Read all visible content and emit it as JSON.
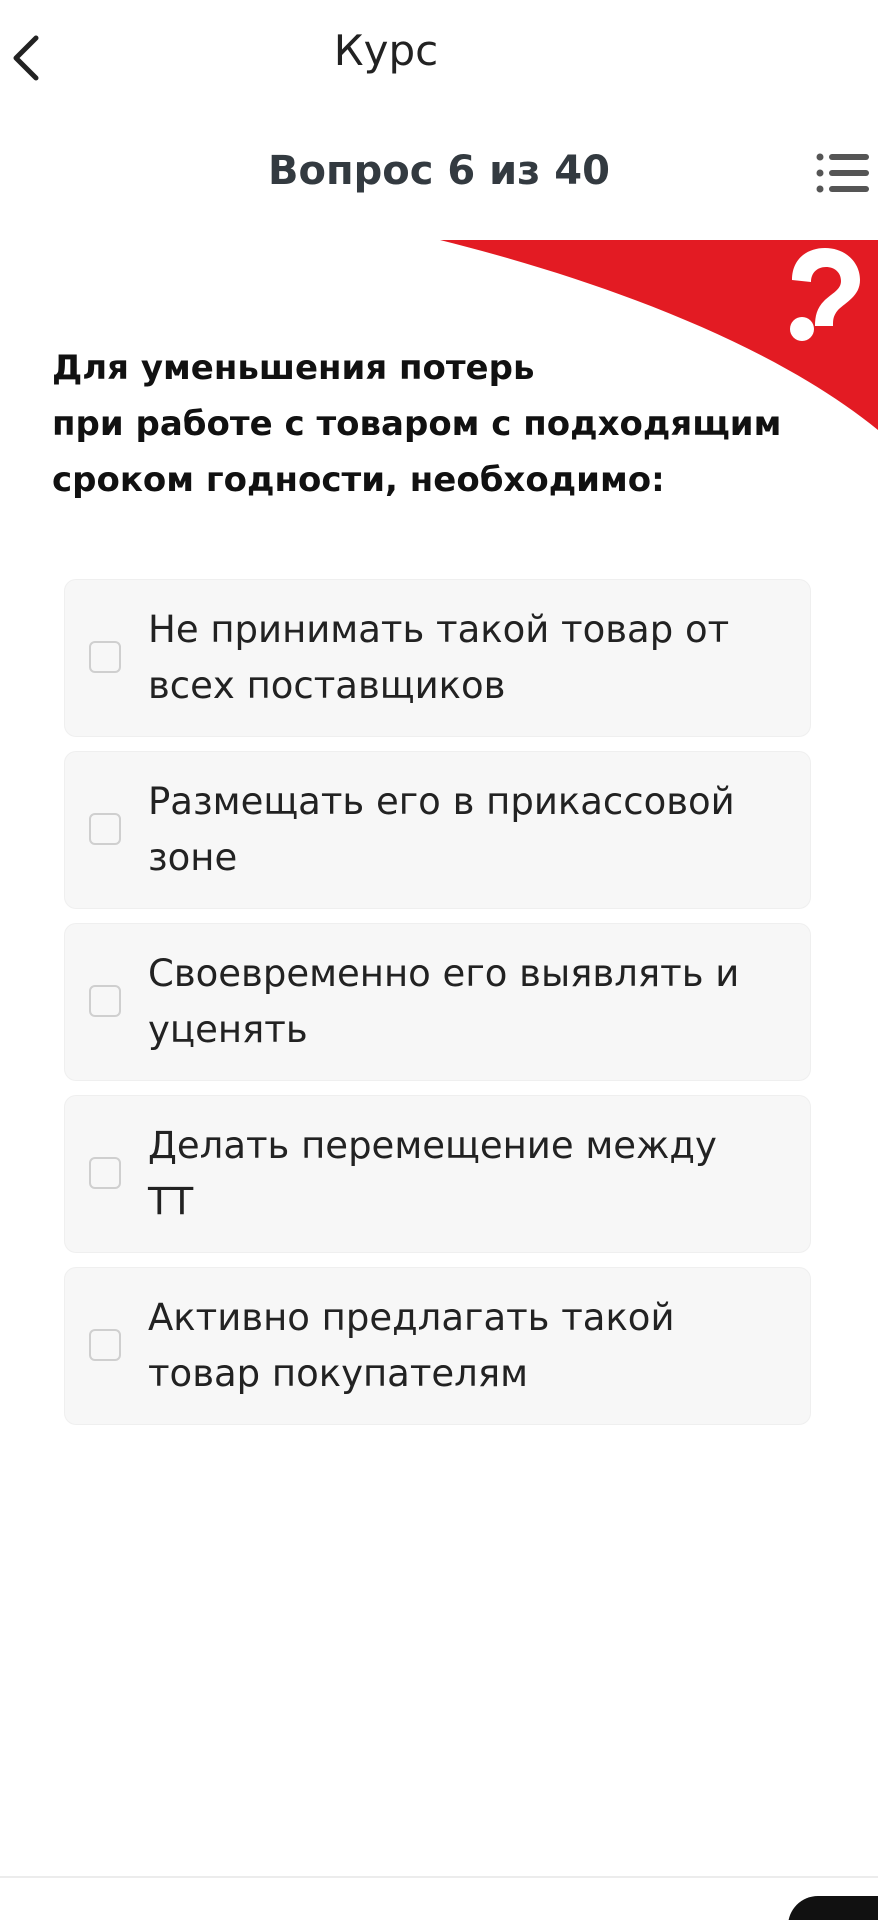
{
  "header": {
    "title": "Курс"
  },
  "progress": {
    "label": "Вопрос 6 из 40",
    "current": 6,
    "total": 40
  },
  "question": {
    "lines": [
      "Для уменьшения потерь",
      "при работе с товаром с подходящим",
      "сроком годности, необходимо:"
    ]
  },
  "options": [
    {
      "label": "Не принимать такой товар от всех поставщиков",
      "checked": false
    },
    {
      "label": "Размещать его в прикассовой зоне",
      "checked": false
    },
    {
      "label": "Своевременно его выявлять и уценять",
      "checked": false
    },
    {
      "label": "Делать перемещение между ТТ",
      "checked": false
    },
    {
      "label": "Активно предлагать такой товар покупателям",
      "checked": false
    }
  ],
  "icons": {
    "back": "chevron-left-icon",
    "menu": "list-menu-icon",
    "banner": "question-mark-icon"
  },
  "colors": {
    "accent": "#e31b23",
    "option_bg": "#f7f7f7",
    "text": "#222222"
  }
}
